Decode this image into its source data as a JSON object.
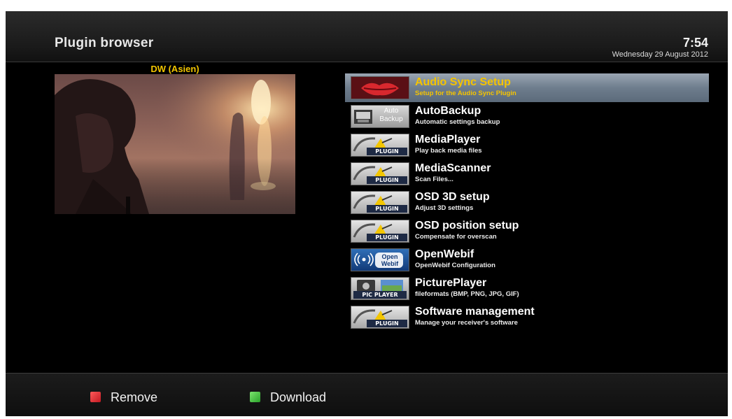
{
  "header": {
    "title": "Plugin browser",
    "time": "7:54",
    "date": "Wednesday 29 August 2012"
  },
  "preview": {
    "channel": "DW (Asien)"
  },
  "plugins": [
    {
      "name": "Audio Sync Setup",
      "description": "Setup for the Audio Sync Plugin",
      "icon": "lips-icon",
      "selected": true
    },
    {
      "name": "AutoBackup",
      "description": "Automatic settings backup",
      "icon": "auto-backup-icon",
      "icon_text": "Auto Backup"
    },
    {
      "name": "MediaPlayer",
      "description": "Play back media files",
      "icon": "plugin-icon",
      "icon_text": "PLUGIN"
    },
    {
      "name": "MediaScanner",
      "description": "Scan Files...",
      "icon": "plugin-icon",
      "icon_text": "PLUGIN"
    },
    {
      "name": "OSD 3D setup",
      "description": "Adjust 3D settings",
      "icon": "plugin-icon",
      "icon_text": "PLUGIN"
    },
    {
      "name": "OSD position setup",
      "description": "Compensate for overscan",
      "icon": "plugin-icon",
      "icon_text": "PLUGIN"
    },
    {
      "name": "OpenWebif",
      "description": "OpenWebif Configuration",
      "icon": "openwebif-icon",
      "icon_text": "Open Webif"
    },
    {
      "name": "PicturePlayer",
      "description": "fileformats (BMP, PNG, JPG, GIF)",
      "icon": "pic-player-icon",
      "icon_text": "PIC PLAYER"
    },
    {
      "name": "Software management",
      "description": "Manage your receiver's software",
      "icon": "plugin-icon",
      "icon_text": "PLUGIN"
    }
  ],
  "footer": {
    "red_label": "Remove",
    "green_label": "Download"
  },
  "colors": {
    "accent_yellow": "#f5c400",
    "selection": "#6e7d8d",
    "red_key": "#d8282e",
    "green_key": "#3fbf3a"
  }
}
